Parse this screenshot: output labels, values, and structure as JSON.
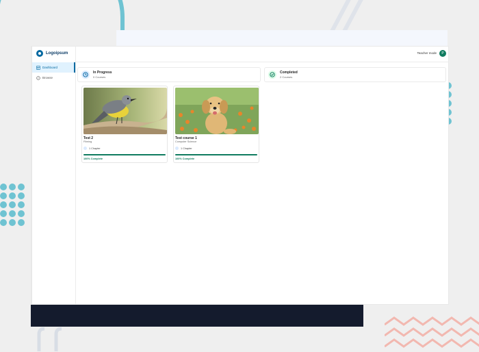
{
  "app": {
    "logo_text": "Logoipsum",
    "teacher_mode_label": "Teacher mode",
    "avatar_initial": "P"
  },
  "sidebar": {
    "items": [
      {
        "label": "Dashboard",
        "icon": "layout-icon",
        "active": true
      },
      {
        "label": "Browse",
        "icon": "compass-icon",
        "active": false
      }
    ]
  },
  "stats": [
    {
      "title": "In Progress",
      "subtitle": "0 Courses",
      "icon": "clock-icon",
      "color": "#0369a1"
    },
    {
      "title": "Completed",
      "subtitle": "2 Courses",
      "icon": "check-circle-icon",
      "color": "#0f7b5f"
    }
  ],
  "courses": [
    {
      "title": "Test 2",
      "category": "Filming",
      "chapters": "1 Chapter",
      "progress": 1.0,
      "status": "100% Complete",
      "image": "bird-photo"
    },
    {
      "title": "Test course 1",
      "category": "Computer Science",
      "chapters": "1 Chapter",
      "progress": 1.0,
      "status": "100% Complete",
      "image": "puppy-photo"
    }
  ],
  "colors": {
    "accent": "#0369a1",
    "success": "#0f7b5f",
    "navy": "#141b2d",
    "teal_decor": "#6fc3d2",
    "pink_decor": "#f2b8b0"
  }
}
